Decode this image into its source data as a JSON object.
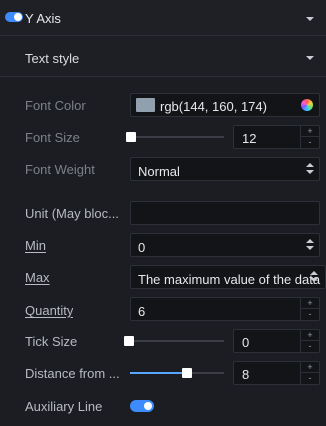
{
  "header": {
    "title": "Y Axis",
    "enabled": true
  },
  "subsection": {
    "title": "Text style"
  },
  "text_style": {
    "font_color": {
      "label": "Font Color",
      "value": "rgb(144, 160, 174)",
      "swatch": "#90a0ae"
    },
    "font_size": {
      "label": "Font Size",
      "value": "12",
      "slider_level": 0
    },
    "font_weight": {
      "label": "Font Weight",
      "value": "Normal"
    }
  },
  "fields": {
    "unit": {
      "label": "Unit (May bloc...",
      "value": ""
    },
    "min": {
      "label": "Min",
      "value": "0"
    },
    "max": {
      "label": "Max",
      "value": "The maximum value of the data"
    },
    "quantity": {
      "label": "Quantity",
      "value": "6"
    },
    "tick_size": {
      "label": "Tick Size",
      "value": "0",
      "slider_level": 0
    },
    "distance": {
      "label": "Distance from ...",
      "value": "8",
      "slider_level": 0.6
    },
    "auxiliary_line": {
      "label": "Auxiliary Line",
      "enabled": true
    }
  },
  "stepper": {
    "up": "+",
    "down": "-"
  },
  "colors": {
    "accent": "#3d8bfd",
    "slider_fill": "#58a7ff",
    "background": "#1b1d23"
  }
}
